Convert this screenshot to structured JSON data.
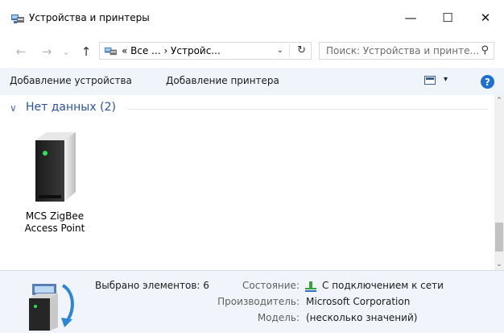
{
  "window": {
    "title": "Устройства и принтеры",
    "minimize_glyph": "—",
    "maximize_glyph": "☐",
    "close_glyph": "✕"
  },
  "nav": {
    "back_glyph": "←",
    "forward_glyph": "→",
    "recent_glyph": "⌄",
    "up_glyph": "↑",
    "address_text": "« Все ... › Устройс...",
    "address_dropdown_glyph": "⌄",
    "refresh_glyph": "↻",
    "search_placeholder": "Поиск: Устройства и принте...",
    "search_glyph": "⚲"
  },
  "commands": {
    "add_device": "Добавление устройства",
    "add_printer": "Добавление принтера",
    "view_dropdown_glyph": "▾",
    "help_glyph": "?"
  },
  "group": {
    "chevron_glyph": "∨",
    "header": "Нет данных (2)",
    "devices": [
      {
        "label_line1": "MCS ZigBee",
        "label_line2": "Access Point",
        "icon": "server-device-icon"
      }
    ]
  },
  "scrollbar": {
    "up_glyph": "⌃",
    "down_glyph": "⌄"
  },
  "details": {
    "selected_text": "Выбрано элементов: 6",
    "rows": [
      {
        "key": "Состояние:",
        "value": "С подключением к сети",
        "icon": "network-icon"
      },
      {
        "key": "Производитель:",
        "value": "Microsoft Corporation"
      },
      {
        "key": "Модель:",
        "value": "(несколько значений)"
      }
    ]
  },
  "colors": {
    "accent": "#2a52a6",
    "command_bar_bg": "#f0f5fb",
    "details_bg": "#f1f5fb",
    "help_blue": "#1f6fd1",
    "device_led": "#2ee05a"
  }
}
